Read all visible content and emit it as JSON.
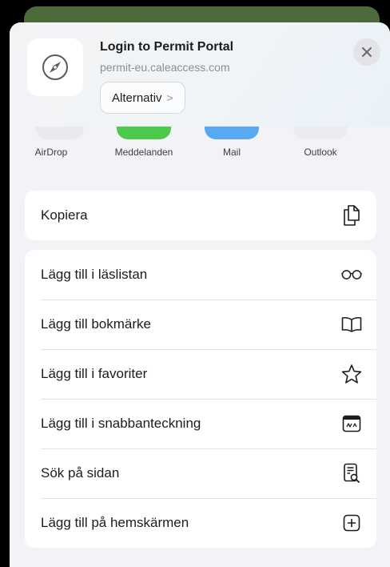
{
  "header": {
    "title": "Login to Permit Portal",
    "url": "permit-eu.caleaccess.com",
    "options_label": "Alternativ",
    "options_chevron": ">",
    "site_icon": "compass-icon",
    "close_icon": "close-icon"
  },
  "apps": [
    {
      "label": "AirDrop",
      "icon": "airdrop-icon",
      "color": "#e9e9ee"
    },
    {
      "label": "Meddelanden",
      "icon": "messages-icon",
      "color": "#4cc84a"
    },
    {
      "label": "Mail",
      "icon": "mail-icon",
      "color": "#57aaf2"
    },
    {
      "label": "Outlook",
      "icon": "outlook-icon",
      "color": "#ececf0"
    }
  ],
  "actions_primary": [
    {
      "label": "Kopiera",
      "icon": "copy-icon"
    }
  ],
  "actions_secondary": [
    {
      "label": "Lägg till i läslistan",
      "icon": "glasses-icon"
    },
    {
      "label": "Lägg till bokmärke",
      "icon": "book-icon"
    },
    {
      "label": "Lägg till i favoriter",
      "icon": "star-icon"
    },
    {
      "label": "Lägg till i snabbanteckning",
      "icon": "quick-note-icon"
    },
    {
      "label": "Sök på sidan",
      "icon": "find-on-page-icon"
    },
    {
      "label": "Lägg till på hemskärmen",
      "icon": "add-square-icon"
    }
  ],
  "colors": {
    "sheet_bg": "#f2f2f7",
    "text": "#1c1c1e",
    "secondary_text": "#8e8e93"
  }
}
